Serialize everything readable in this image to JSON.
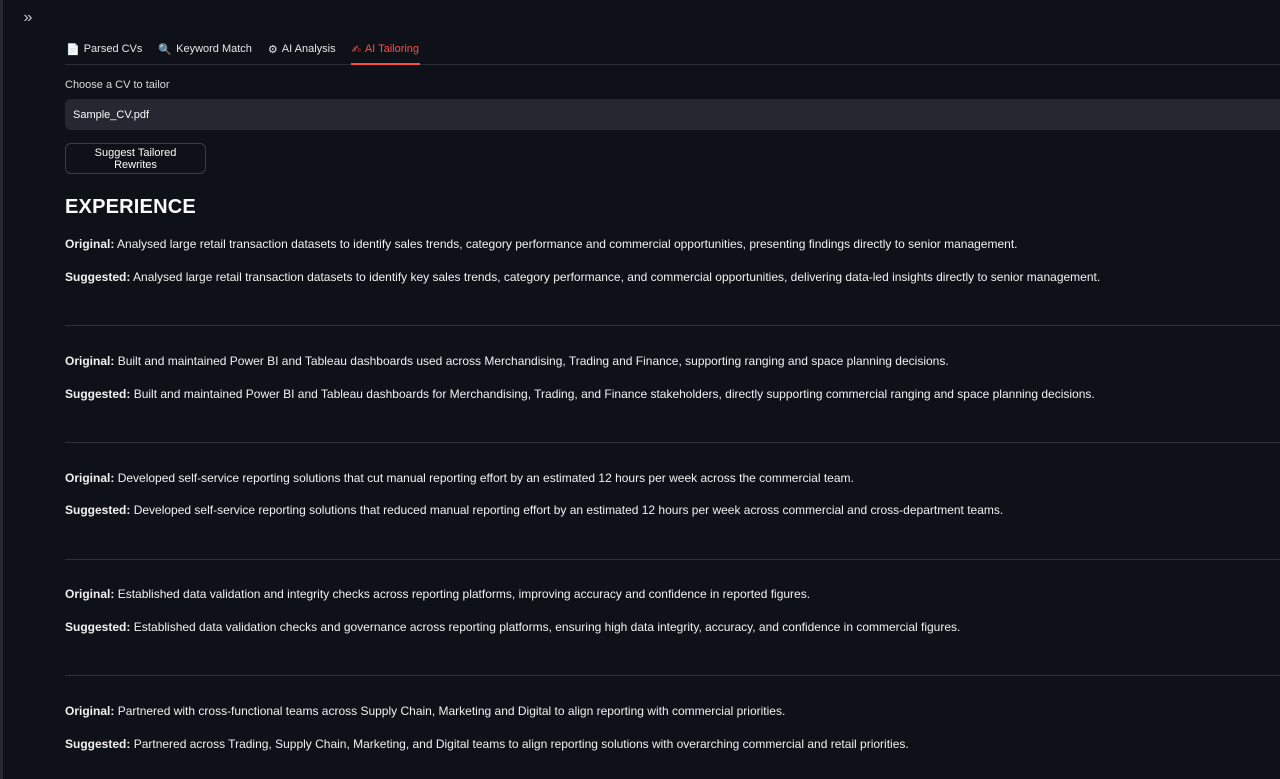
{
  "tabs": [
    {
      "icon": "📄",
      "label": "Parsed CVs",
      "active": false
    },
    {
      "icon": "🔍",
      "label": "Keyword Match",
      "active": false
    },
    {
      "icon": "⚙",
      "label": "AI Analysis",
      "active": false
    },
    {
      "icon": "✍",
      "label": "AI Tailoring",
      "active": true
    }
  ],
  "selector": {
    "label": "Choose a CV to tailor",
    "value": "Sample_CV.pdf"
  },
  "button": {
    "label": "Suggest Tailored Rewrites"
  },
  "section": {
    "title": "EXPERIENCE"
  },
  "labels": {
    "original": "Original:",
    "suggested": "Suggested:"
  },
  "items": [
    {
      "original": "Analysed large retail transaction datasets to identify sales trends, category performance and commercial opportunities, presenting findings directly to senior management.",
      "suggested": "Analysed large retail transaction datasets to identify key sales trends, category performance, and commercial opportunities, delivering data-led insights directly to senior management."
    },
    {
      "original": "Built and maintained Power BI and Tableau dashboards used across Merchandising, Trading and Finance, supporting ranging and space planning decisions.",
      "suggested": "Built and maintained Power BI and Tableau dashboards for Merchandising, Trading, and Finance stakeholders, directly supporting commercial ranging and space planning decisions."
    },
    {
      "original": "Developed self-service reporting solutions that cut manual reporting effort by an estimated 12 hours per week across the commercial team.",
      "suggested": "Developed self-service reporting solutions that reduced manual reporting effort by an estimated 12 hours per week across commercial and cross-department teams."
    },
    {
      "original": "Established data validation and integrity checks across reporting platforms, improving accuracy and confidence in reported figures.",
      "suggested": "Established data validation checks and governance across reporting platforms, ensuring high data integrity, accuracy, and confidence in commercial figures."
    },
    {
      "original": "Partnered with cross-functional teams across Supply Chain, Marketing and Digital to align reporting with commercial priorities.",
      "suggested": "Partnered across Trading, Supply Chain, Marketing, and Digital teams to align reporting solutions with overarching commercial and retail priorities."
    }
  ]
}
